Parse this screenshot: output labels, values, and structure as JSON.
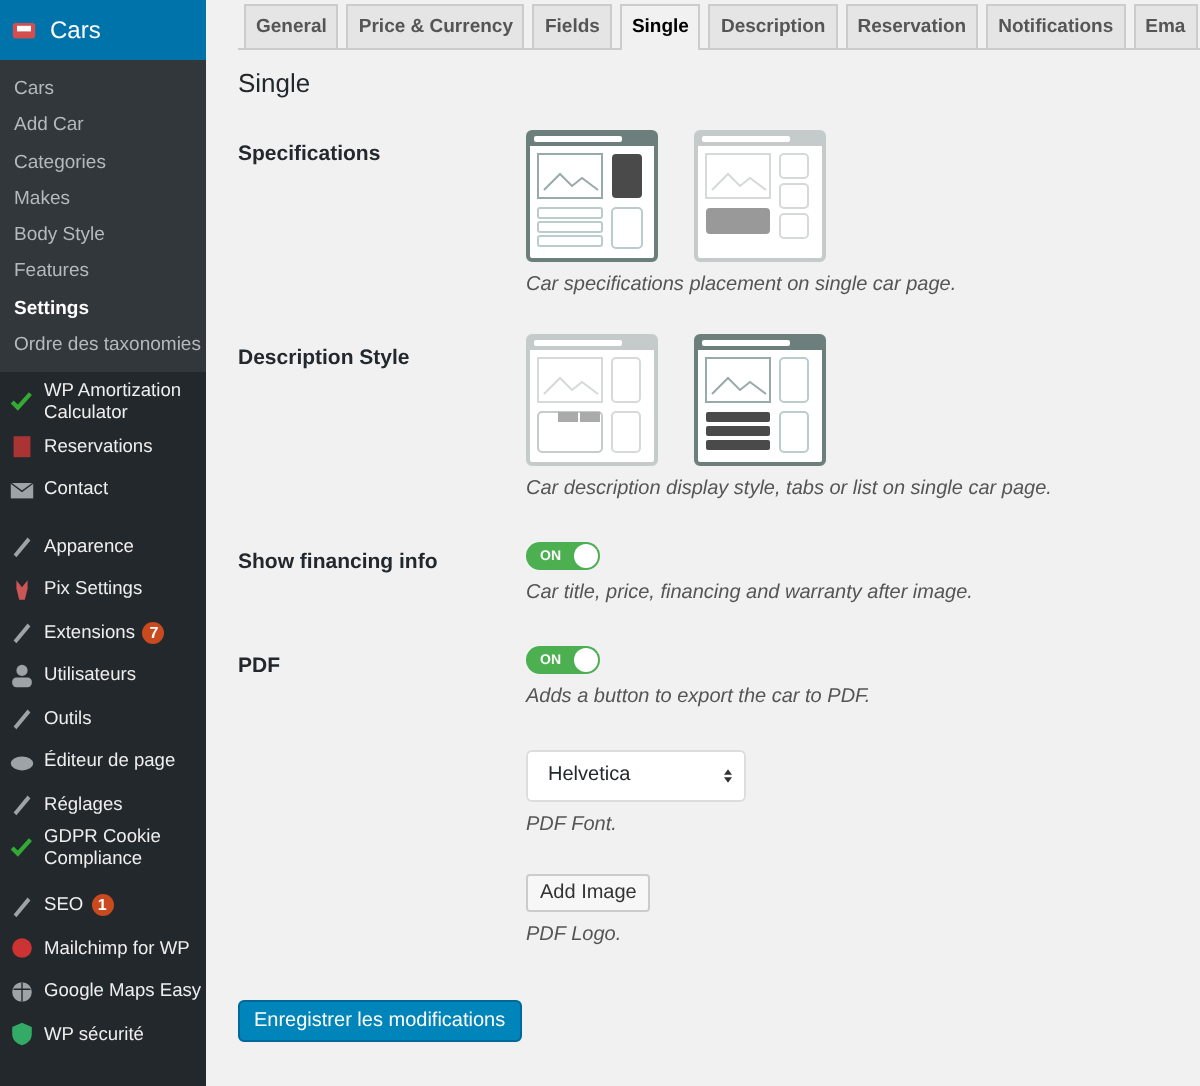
{
  "sidebar": {
    "header": {
      "label": "Cars",
      "selected": true
    },
    "submenu": [
      {
        "label": "Cars",
        "selected": false
      },
      {
        "label": "Add Car",
        "selected": false
      },
      {
        "label": "Categories",
        "selected": false
      },
      {
        "label": "Makes",
        "selected": false
      },
      {
        "label": "Body Style",
        "selected": false
      },
      {
        "label": "Features",
        "selected": false
      },
      {
        "label": "Settings",
        "selected": true
      },
      {
        "label": "Ordre des taxonomies",
        "selected": false
      }
    ],
    "groups": [
      [
        {
          "label": "WP Amortization Calculator"
        },
        {
          "label": "Reservations"
        },
        {
          "label": "Contact"
        }
      ],
      [
        {
          "label": "Apparence"
        },
        {
          "label": "Pix Settings"
        },
        {
          "label": "Extensions",
          "badge": "7"
        },
        {
          "label": "Utilisateurs"
        },
        {
          "label": "Outils"
        },
        {
          "label": "Éditeur de page"
        },
        {
          "label": "Réglages"
        },
        {
          "label": "GDPR Cookie Compliance"
        }
      ],
      [
        {
          "label": "SEO",
          "badge": "1"
        },
        {
          "label": "Mailchimp for WP"
        },
        {
          "label": "Google Maps Easy"
        },
        {
          "label": "WP sécurité"
        }
      ]
    ]
  },
  "tabs": [
    {
      "label": "General",
      "selected": false
    },
    {
      "label": "Price & Currency",
      "selected": false
    },
    {
      "label": "Fields",
      "selected": false
    },
    {
      "label": "Single",
      "selected": true
    },
    {
      "label": "Description",
      "selected": false
    },
    {
      "label": "Reservation",
      "selected": false
    },
    {
      "label": "Notifications",
      "selected": false
    },
    {
      "label": "Ema",
      "selected": false
    }
  ],
  "section_title": "Single",
  "fields": [
    {
      "kind": "layouts",
      "label": "Specifications",
      "options": [
        {
          "kind": "sidebar",
          "selected": true
        },
        {
          "kind": "below",
          "selected": false
        }
      ],
      "description": "Car specifications placement on single car page."
    },
    {
      "kind": "layouts",
      "label": "Description Style",
      "options": [
        {
          "kind": "tabs",
          "selected": false
        },
        {
          "kind": "list",
          "selected": true
        }
      ],
      "description": "Car description display style, tabs or list on single car page."
    },
    {
      "kind": "toggle",
      "label": "Show financing info",
      "on": true,
      "toggle_text": "ON",
      "description": "Car title, price, financing and warranty after image."
    },
    {
      "kind": "toggle",
      "label": "PDF",
      "on": true,
      "toggle_text": "ON",
      "description": "Adds a button to export the car to PDF."
    },
    {
      "kind": "select",
      "value": "Helvetica",
      "description": "PDF Font."
    },
    {
      "kind": "button",
      "button": "Add Image",
      "description": "PDF Logo."
    }
  ],
  "save_button": "Enregistrer les modifications"
}
